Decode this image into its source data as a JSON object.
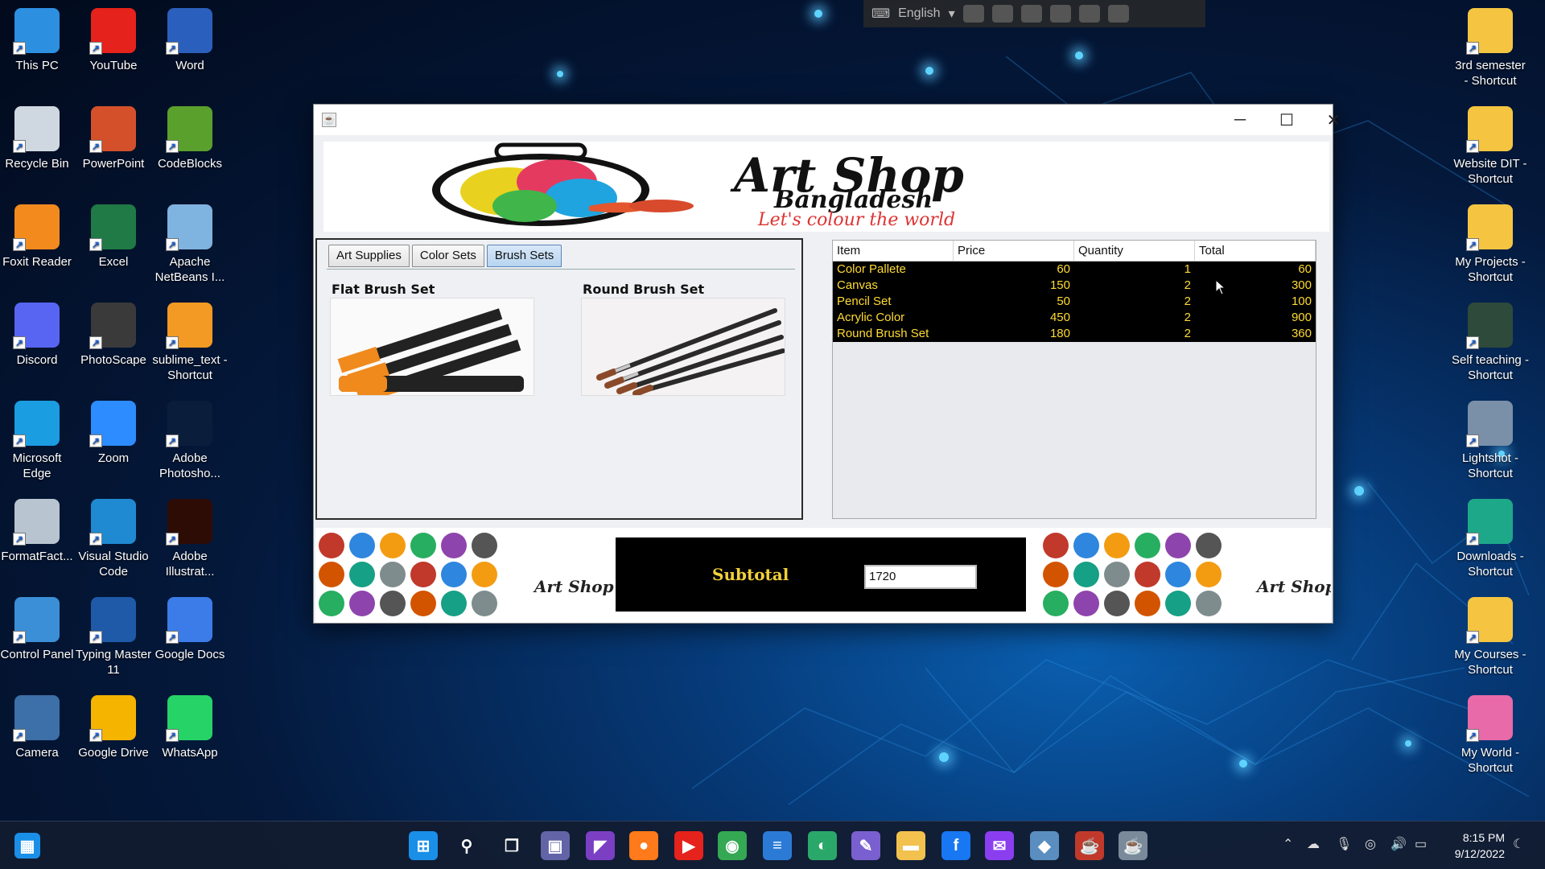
{
  "desktop_left": [
    {
      "label": "This PC",
      "icon": "monitor-icon",
      "color": "#2d8fe0"
    },
    {
      "label": "YouTube",
      "icon": "youtube-icon",
      "color": "#e5221b"
    },
    {
      "label": "Word",
      "icon": "word-icon",
      "color": "#2b5fbd"
    },
    {
      "label": "Recycle Bin",
      "icon": "recycle-bin-icon",
      "color": "#cfd8e0"
    },
    {
      "label": "PowerPoint",
      "icon": "powerpoint-icon",
      "color": "#d4502b"
    },
    {
      "label": "CodeBlocks",
      "icon": "codeblocks-icon",
      "color": "#5aa02c"
    },
    {
      "label": "Foxit Reader",
      "icon": "foxit-reader-icon",
      "color": "#f28a1e"
    },
    {
      "label": "Excel",
      "icon": "excel-icon",
      "color": "#1f7a45"
    },
    {
      "label": "Apache NetBeans I...",
      "icon": "netbeans-icon",
      "color": "#7fb3e0"
    },
    {
      "label": "Discord",
      "icon": "discord-icon",
      "color": "#5865f2"
    },
    {
      "label": "PhotoScape",
      "icon": "photoscape-icon",
      "color": "#3a3a3a"
    },
    {
      "label": "sublime_text - Shortcut",
      "icon": "sublime-text-icon",
      "color": "#f29a23"
    },
    {
      "label": "Microsoft Edge",
      "icon": "edge-icon",
      "color": "#1b9de2"
    },
    {
      "label": "Zoom",
      "icon": "zoom-icon",
      "color": "#2d8cff"
    },
    {
      "label": "Adobe Photosho...",
      "icon": "photoshop-icon",
      "color": "#0a1e3c"
    },
    {
      "label": "FormatFact...",
      "icon": "format-factory-icon",
      "color": "#b8c4d0"
    },
    {
      "label": "Visual Studio Code",
      "icon": "vscode-icon",
      "color": "#1f8ad2"
    },
    {
      "label": "Adobe Illustrat...",
      "icon": "illustrator-icon",
      "color": "#2d0c06"
    },
    {
      "label": "Control Panel",
      "icon": "control-panel-icon",
      "color": "#3b8fd6"
    },
    {
      "label": "Typing Master 11",
      "icon": "typing-master-icon",
      "color": "#1e5aa8"
    },
    {
      "label": "Google Docs",
      "icon": "google-docs-icon",
      "color": "#3b7ce8"
    },
    {
      "label": "Camera",
      "icon": "camera-icon",
      "color": "#3d6fa8"
    },
    {
      "label": "Google Drive",
      "icon": "google-drive-icon",
      "color": "#f5b400"
    },
    {
      "label": "WhatsApp",
      "icon": "whatsapp-icon",
      "color": "#25d366"
    }
  ],
  "desktop_right": [
    {
      "label": "3rd semester - Shortcut",
      "icon": "folder-icon",
      "color": "#f5c542"
    },
    {
      "label": "Website DIT - Shortcut",
      "icon": "folder-icon",
      "color": "#f5c542"
    },
    {
      "label": "My Projects - Shortcut",
      "icon": "folder-icon",
      "color": "#f5c542"
    },
    {
      "label": "Self teaching - Shortcut",
      "icon": "person-image-icon",
      "color": "#2e4a3a"
    },
    {
      "label": "Lightshot - Shortcut",
      "icon": "lightshot-icon",
      "color": "#7a8fa8"
    },
    {
      "label": "Downloads - Shortcut",
      "icon": "downloads-icon",
      "color": "#1ea88a"
    },
    {
      "label": "My Courses - Shortcut",
      "icon": "folder-icon",
      "color": "#f5c542"
    },
    {
      "label": "My World - Shortcut",
      "icon": "butterfly-icon",
      "color": "#e86aa8"
    }
  ],
  "langbar": {
    "language": "English"
  },
  "app": {
    "banner": {
      "title": "Art Shop",
      "subtitle": "Bangladesh",
      "tagline": "Let's colour the world"
    },
    "tabs": [
      "Art Supplies",
      "Color Sets",
      "Brush Sets"
    ],
    "active_tab": "Brush Sets",
    "products": [
      {
        "name": "Flat Brush Set"
      },
      {
        "name": "Round Brush Set"
      }
    ],
    "table": {
      "columns": [
        "Item",
        "Price",
        "Quantity",
        "Total"
      ],
      "rows": [
        {
          "item": "Color Pallete",
          "price": "60",
          "qty": "1",
          "total": "60"
        },
        {
          "item": "Canvas",
          "price": "150",
          "qty": "2",
          "total": "300"
        },
        {
          "item": "Pencil Set",
          "price": "50",
          "qty": "2",
          "total": "100"
        },
        {
          "item": "Acrylic Color",
          "price": "450",
          "qty": "2",
          "total": "900"
        },
        {
          "item": "Round Brush Set",
          "price": "180",
          "qty": "2",
          "total": "360"
        }
      ]
    },
    "subtotal": {
      "label": "Subtotal",
      "value": "1720"
    },
    "strip_logo": "Art Shop"
  },
  "taskbar": {
    "apps": [
      {
        "name": "windows-logo-icon",
        "glyph": "⊞",
        "color": "#1a8fe8"
      },
      {
        "name": "search-icon",
        "glyph": "⚲",
        "color": "transparent"
      },
      {
        "name": "task-view-icon",
        "glyph": "❐",
        "color": "transparent"
      },
      {
        "name": "teams-chat-icon",
        "glyph": "▣",
        "color": "#6264a7"
      },
      {
        "name": "visual-studio-icon",
        "glyph": "◤",
        "color": "#7b3fc4"
      },
      {
        "name": "firefox-icon",
        "glyph": "●",
        "color": "#ff7a1a"
      },
      {
        "name": "youtube-icon",
        "glyph": "▶",
        "color": "#e5221b"
      },
      {
        "name": "chrome-icon",
        "glyph": "◉",
        "color": "#34a853"
      },
      {
        "name": "notepad-icon",
        "glyph": "≡",
        "color": "#2b7bd6"
      },
      {
        "name": "earth-icon",
        "glyph": "◐",
        "color": "#2aa86a"
      },
      {
        "name": "feather-icon",
        "glyph": "✎",
        "color": "#7a5fd0"
      },
      {
        "name": "file-explorer-icon",
        "glyph": "▬",
        "color": "#f2c14e"
      },
      {
        "name": "facebook-icon",
        "glyph": "f",
        "color": "#1877f2"
      },
      {
        "name": "messenger-icon",
        "glyph": "✉",
        "color": "#8a3ef0"
      },
      {
        "name": "netbeans-taskbar-icon",
        "glyph": "◆",
        "color": "#5a8ec0"
      },
      {
        "name": "java-app-icon",
        "glyph": "☕",
        "color": "#c0392b"
      },
      {
        "name": "java-app-2-icon",
        "glyph": "☕",
        "color": "#7a8a9a"
      }
    ],
    "time": "8:15 PM",
    "date": "9/12/2022"
  }
}
